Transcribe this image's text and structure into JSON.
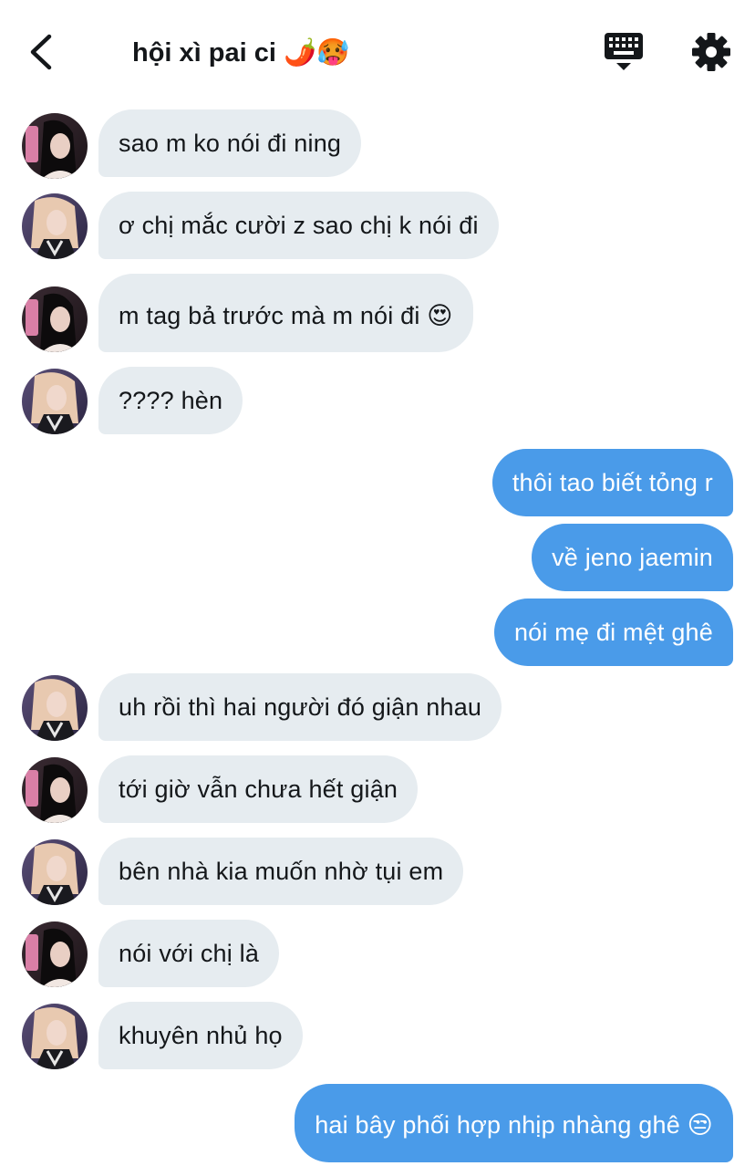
{
  "header": {
    "title": "hội xì pai ci 🌶️🥵",
    "back_icon": "chevron-left-icon",
    "keyboard_icon": "keyboard-icon",
    "settings_icon": "gear-icon"
  },
  "colors": {
    "incoming_bubble": "#e6ecf0",
    "outgoing_bubble": "#4a9be9",
    "text_dark": "#14171a",
    "text_light": "#ffffff"
  },
  "messages": [
    {
      "dir": "in",
      "sender": "a",
      "text": "sao m ko nói đi ning"
    },
    {
      "dir": "in",
      "sender": "b",
      "text": "ơ chị mắc cười z sao chị k nói đi"
    },
    {
      "dir": "in",
      "sender": "a",
      "text": "m tag bả trước mà m nói đi 😍"
    },
    {
      "dir": "in",
      "sender": "b",
      "text": "???? hèn"
    },
    {
      "dir": "out",
      "text": "thôi tao biết tỏng r"
    },
    {
      "dir": "out",
      "text": "về jeno jaemin"
    },
    {
      "dir": "out",
      "text": "nói mẹ đi mệt ghê"
    },
    {
      "dir": "in",
      "sender": "b",
      "text": "uh rồi thì hai người đó giận nhau"
    },
    {
      "dir": "in",
      "sender": "a",
      "text": "tới giờ vẫn chưa hết giận"
    },
    {
      "dir": "in",
      "sender": "b",
      "text": "bên nhà kia muốn nhờ tụi em"
    },
    {
      "dir": "in",
      "sender": "a",
      "text": "nói với chị là"
    },
    {
      "dir": "in",
      "sender": "b",
      "text": "khuyên nhủ họ"
    },
    {
      "dir": "out",
      "text": "hai bây phối hợp nhịp nhàng ghê 😒"
    }
  ]
}
